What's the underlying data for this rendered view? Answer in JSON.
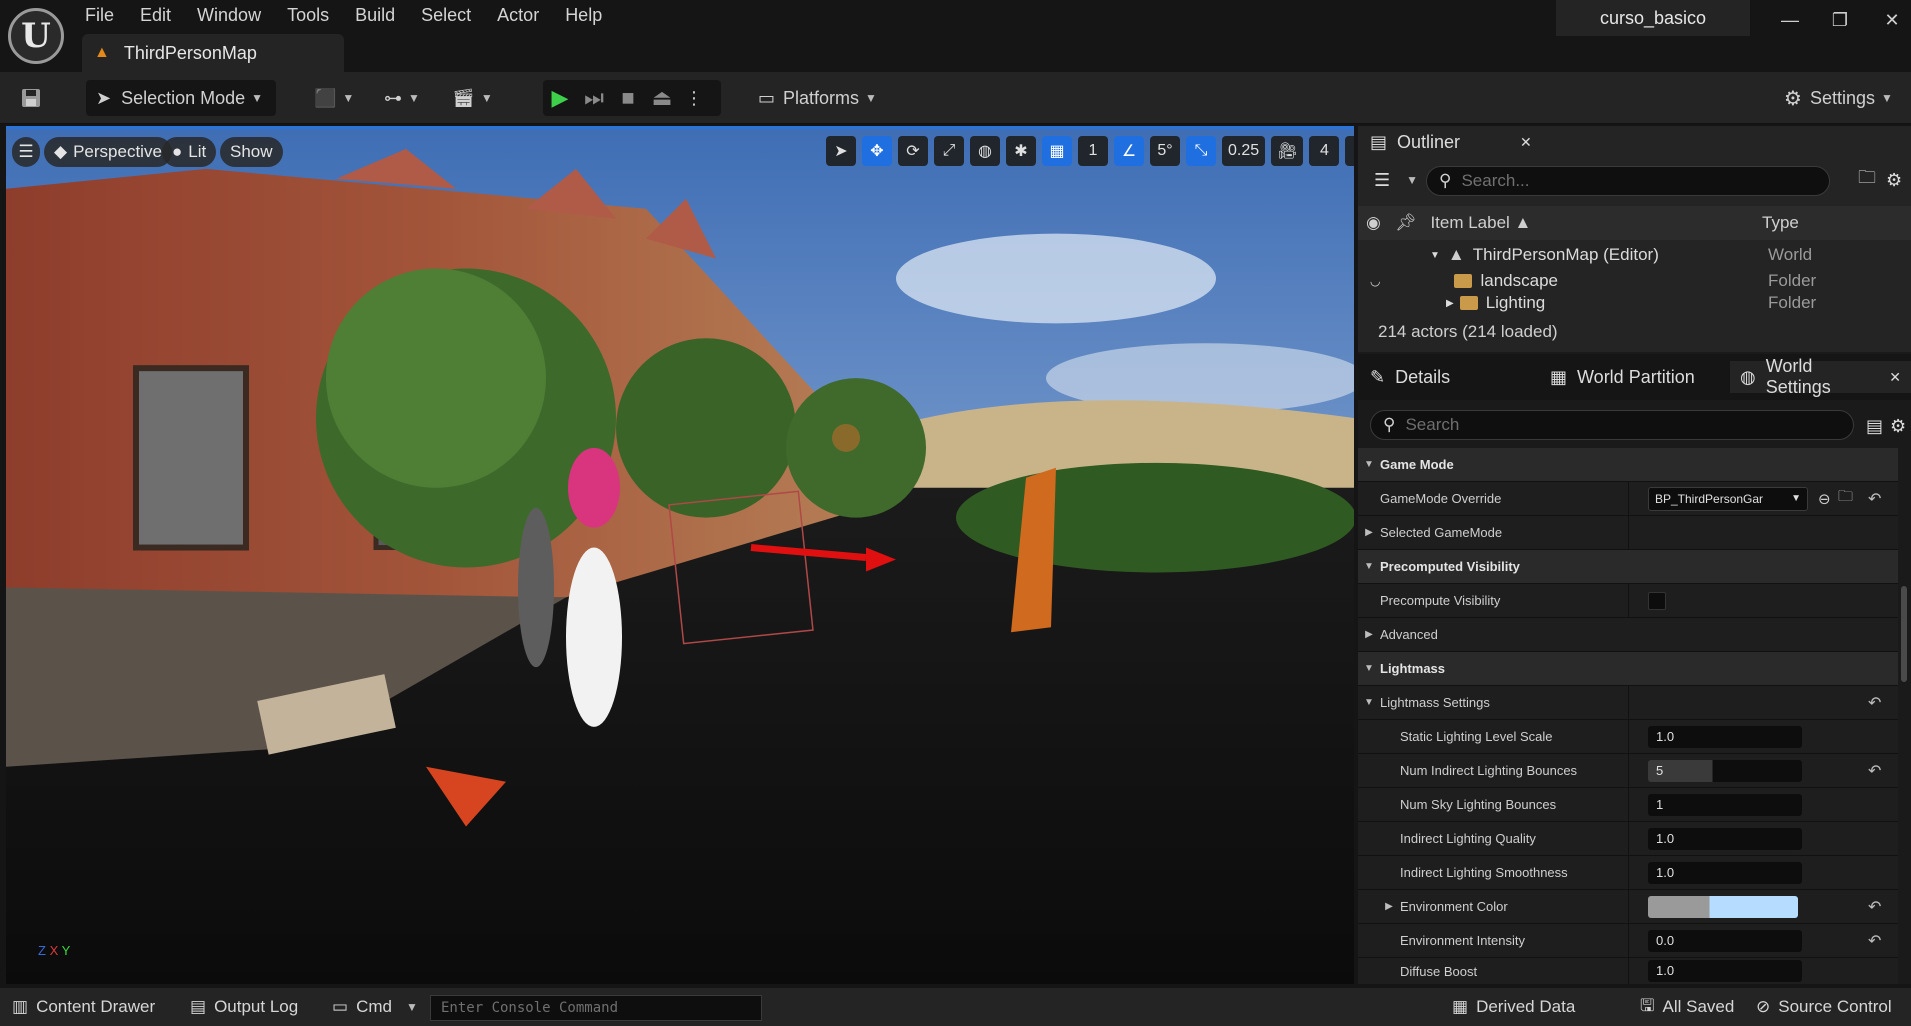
{
  "app": {
    "logo_text": "U",
    "project_name": "curso_basico",
    "map_tab": "ThirdPersonMap"
  },
  "menu": [
    "File",
    "Edit",
    "Window",
    "Tools",
    "Build",
    "Select",
    "Actor",
    "Help"
  ],
  "window_controls": {
    "minimize": "—",
    "restore": "❐",
    "close": "✕"
  },
  "toolbar": {
    "selection_mode": "Selection Mode",
    "platforms": "Platforms",
    "settings": "Settings"
  },
  "viewport": {
    "perspective": "Perspective",
    "lit": "Lit",
    "show": "Show",
    "grid_snap": "1",
    "rotation_snap": "5°",
    "scale_snap": "0.25",
    "camera_speed": "4",
    "axis": {
      "z": "Z",
      "x": "X",
      "y": "Y"
    }
  },
  "outliner": {
    "title": "Outliner",
    "search_placeholder": "Search...",
    "col_label": "Item Label ▲",
    "col_type": "Type",
    "rows": [
      {
        "label": "ThirdPersonMap (Editor)",
        "type": "World"
      },
      {
        "label": "landscape",
        "type": "Folder"
      },
      {
        "label": "Lighting",
        "type": "Folder"
      }
    ],
    "actor_count": "214 actors (214 loaded)"
  },
  "details": {
    "tabs": [
      "Details",
      "World Partition",
      "World Settings"
    ],
    "search_placeholder": "Search",
    "properties": [
      {
        "kind": "cat",
        "name": "Game Mode"
      },
      {
        "kind": "row",
        "name": "GameMode Override",
        "value": "BP_ThirdPersonGar"
      },
      {
        "kind": "row",
        "name": "Selected GameMode"
      },
      {
        "kind": "cat",
        "name": "Precomputed Visibility"
      },
      {
        "kind": "row",
        "name": "Precompute Visibility"
      },
      {
        "kind": "row",
        "name": "Advanced"
      },
      {
        "kind": "cat",
        "name": "Lightmass"
      },
      {
        "kind": "row",
        "name": "Lightmass Settings"
      },
      {
        "kind": "row",
        "name": "Static Lighting Level Scale",
        "value": "1.0"
      },
      {
        "kind": "row",
        "name": "Num Indirect Lighting Bounces",
        "value": "5"
      },
      {
        "kind": "row",
        "name": "Num Sky Lighting Bounces",
        "value": "1"
      },
      {
        "kind": "row",
        "name": "Indirect Lighting Quality",
        "value": "1.0"
      },
      {
        "kind": "row",
        "name": "Indirect Lighting Smoothness",
        "value": "1.0"
      },
      {
        "kind": "row",
        "name": "Environment Color"
      },
      {
        "kind": "row",
        "name": "Environment Intensity",
        "value": "0.0"
      },
      {
        "kind": "row",
        "name": "Diffuse Boost",
        "value": "1.0"
      }
    ]
  },
  "statusbar": {
    "content_drawer": "Content Drawer",
    "output_log": "Output Log",
    "cmd": "Cmd",
    "console_placeholder": "Enter Console Command",
    "derived_data": "Derived Data",
    "all_saved": "All Saved",
    "source_control": "Source Control"
  },
  "colors": {
    "accent": "#1f6fe0",
    "play": "#3ed04a",
    "panel": "#242424",
    "background": "#151515"
  }
}
